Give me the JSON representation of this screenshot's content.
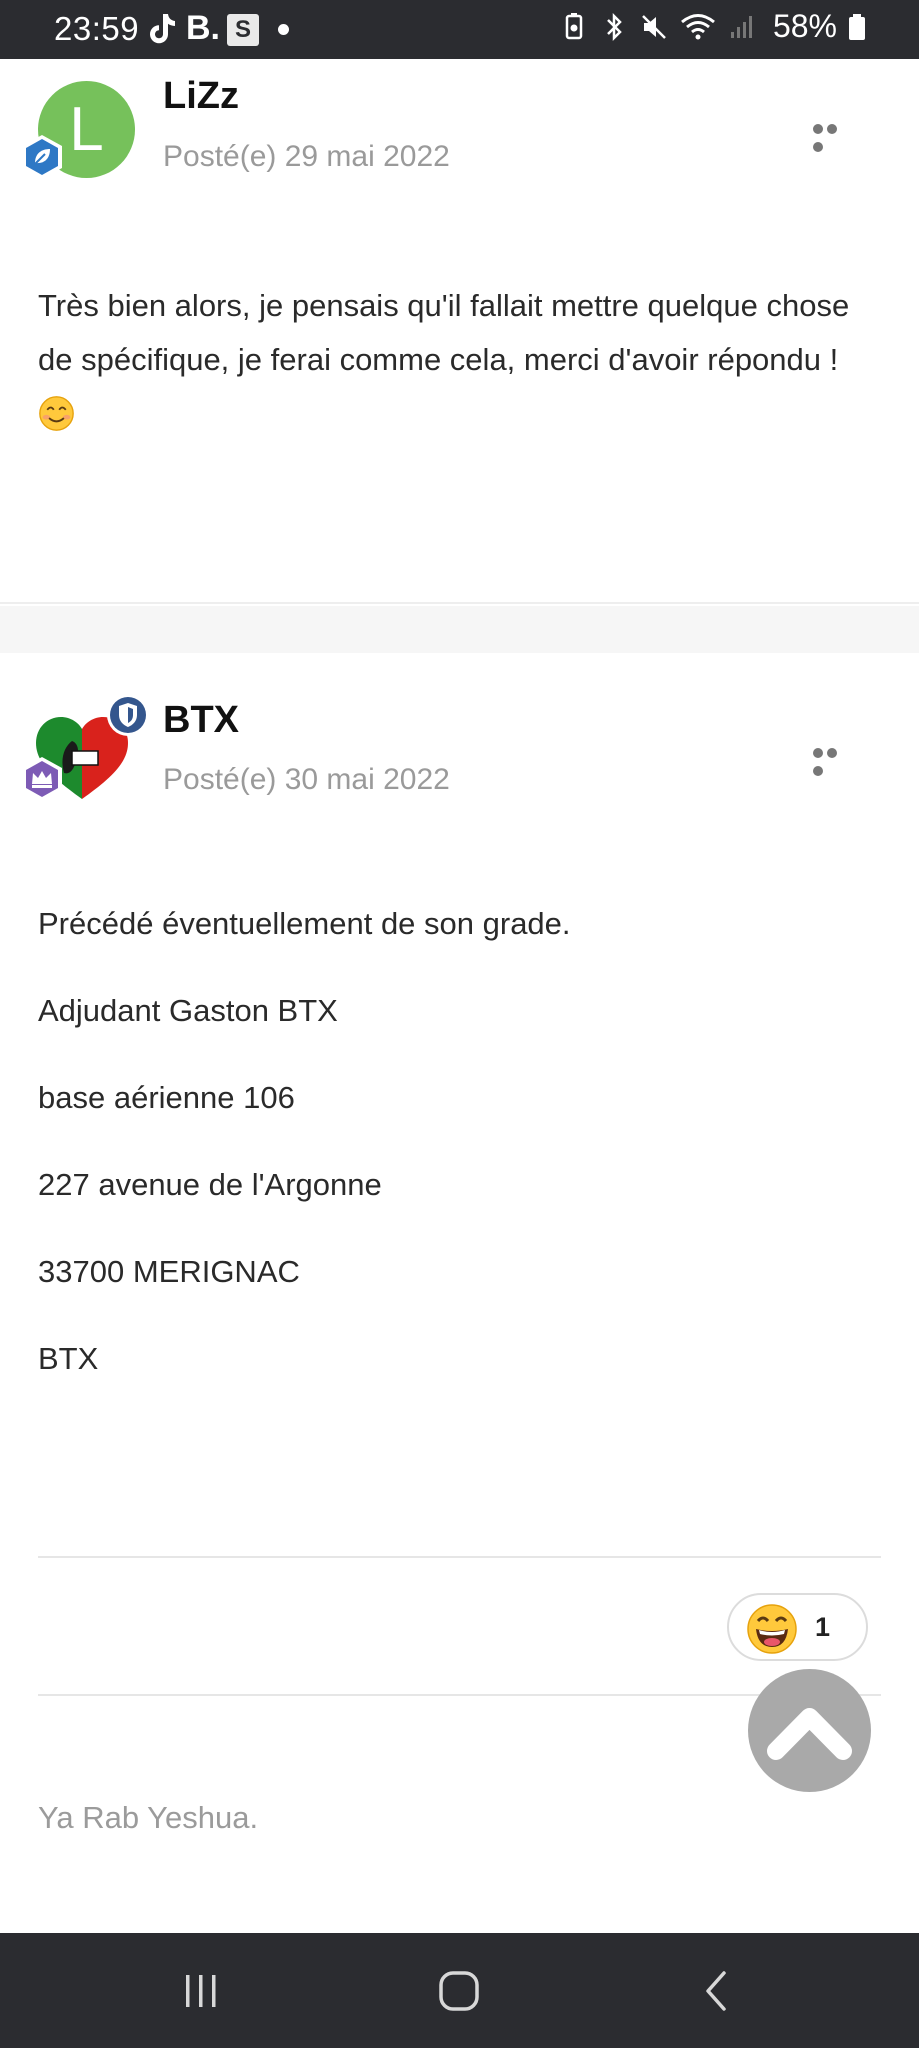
{
  "status_bar": {
    "time": "23:59",
    "app_b": "B.",
    "app_s": "S",
    "battery_percent": "58%",
    "icons": [
      "tiktok-icon",
      "battery-saver-icon",
      "bluetooth-icon",
      "mute-icon",
      "wifi-icon",
      "signal-icon",
      "battery-icon"
    ]
  },
  "post1": {
    "avatar_letter": "L",
    "avatar_color": "#76c15b",
    "author": "LiZz",
    "posted": "Posté(e) 29 mai 2022",
    "body": "Très bien alors, je pensais qu'il fallait mettre quelque chose de spécifique, je ferai comme cela, merci d'avoir répondu ! "
  },
  "post2": {
    "author": "BTX",
    "posted": "Posté(e) 30 mai 2022",
    "lines": [
      "Précédé éventuellement de son grade.",
      "Adjudant Gaston BTX",
      "base aérienne 106",
      "227 avenue de l'Argonne",
      "33700 MERIGNAC",
      "BTX"
    ],
    "reaction_count": "1",
    "signature": "Ya Rab Yeshua."
  },
  "colors": {
    "status_bar": "#2b2c30",
    "accent_green": "#76c15b",
    "badge_blue": "#2e78c5",
    "scroll_top": "#a9a9a9"
  }
}
